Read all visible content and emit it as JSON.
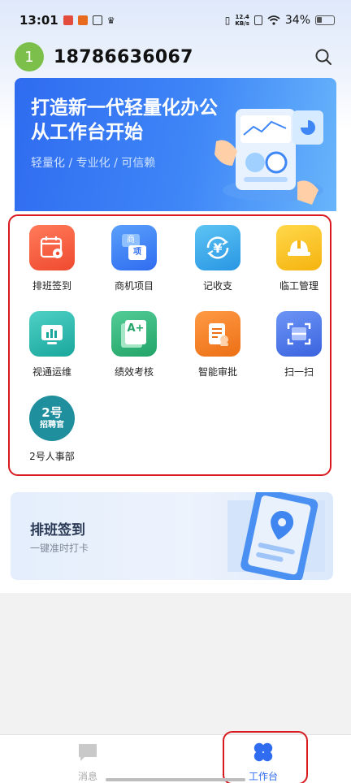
{
  "status_bar": {
    "time": "13:01",
    "net_speed_value": "12.4",
    "net_speed_unit": "KB/s",
    "battery": "34%"
  },
  "header": {
    "avatar_text": "1",
    "user_name": "18786636067"
  },
  "banner": {
    "title_line1": "打造新一代轻量化办公",
    "title_line2": "从工作台开始",
    "subtitle": "轻量化 / 专业化 / 可信赖"
  },
  "apps": [
    {
      "label": "排班签到",
      "icon": "calendar-pin-icon",
      "color": "#f2533a"
    },
    {
      "label": "商机项目",
      "icon": "business-project-icon",
      "color": "#3f86f0",
      "glyph_top": "商",
      "glyph_bottom": "项"
    },
    {
      "label": "记收支",
      "icon": "yuan-cycle-icon",
      "color": "#35a9e8",
      "glyph": "¥"
    },
    {
      "label": "临工管理",
      "icon": "hard-hat-icon",
      "color": "#f8c21c"
    },
    {
      "label": "视通运维",
      "icon": "monitor-chart-icon",
      "color": "#23b7ac"
    },
    {
      "label": "绩效考核",
      "icon": "grade-a-plus-icon",
      "color": "#2fb87e",
      "glyph": "A+"
    },
    {
      "label": "智能审批",
      "icon": "approval-doc-icon",
      "color": "#f07e25"
    },
    {
      "label": "扫一扫",
      "icon": "scan-icon",
      "color": "#3d6ee8"
    },
    {
      "label": "2号人事部",
      "icon": "recruiter-badge-icon",
      "color": "#1f8f9e",
      "glyph_top": "2号",
      "glyph_bottom": "招聘官"
    }
  ],
  "schedule_card": {
    "title": "排班签到",
    "subtitle": "一键准时打卡"
  },
  "bottom_nav": [
    {
      "label": "消息",
      "icon": "message-icon",
      "active": false
    },
    {
      "label": "工作台",
      "icon": "workbench-icon",
      "active": true
    }
  ],
  "colors": {
    "accent": "#2f6cf0",
    "highlight_box": "#d8191f",
    "nav_inactive": "#a9a9a9"
  }
}
